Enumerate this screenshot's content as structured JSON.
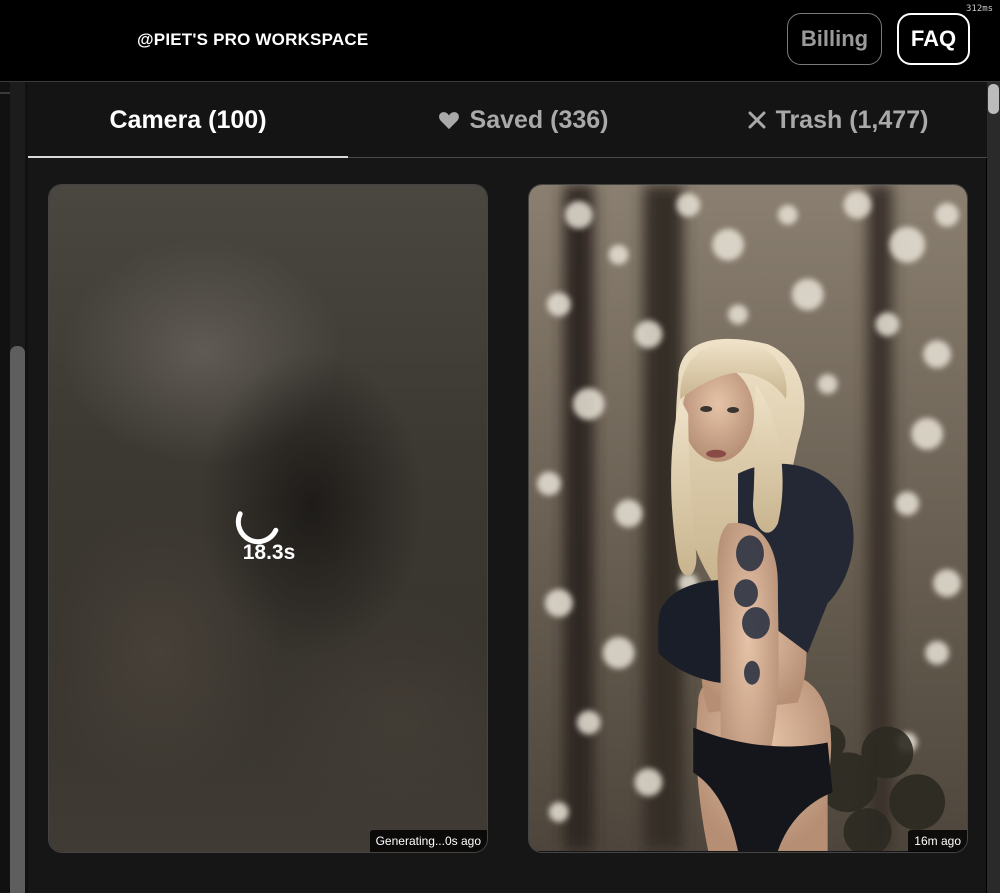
{
  "header": {
    "workspace_title": "@PIET'S PRO WORKSPACE",
    "billing_label": "Billing",
    "faq_label": "FAQ",
    "timing": "312ms"
  },
  "tabs": [
    {
      "label": "Camera (100)",
      "icon": "",
      "active": true
    },
    {
      "label": "Saved (336)",
      "icon": "heart-icon",
      "active": false
    },
    {
      "label": "Trash (1,477)",
      "icon": "x-icon",
      "active": false
    }
  ],
  "cards": [
    {
      "state": "generating",
      "elapsed": "18.3s",
      "badge": "Generating...0s ago"
    },
    {
      "state": "done",
      "badge": "16m ago",
      "watermark": "unnoticeable"
    }
  ],
  "colors": {
    "background": "#000000",
    "panel": "#161616",
    "active_tab": "#ffffff",
    "inactive_tab": "#a9a9a9"
  }
}
